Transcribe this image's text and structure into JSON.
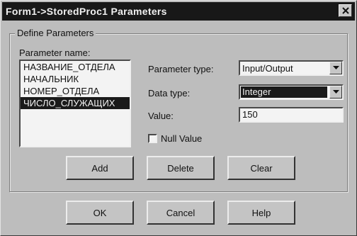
{
  "window": {
    "title": "Form1->StoredProc1 Parameters"
  },
  "group": {
    "title": "Define Parameters",
    "param_name_label": "Parameter name:",
    "parameters": [
      "НАЗВАНИЕ_ОТДЕЛА",
      "НАЧАЛЬНИК",
      "НОМЕР_ОТДЕЛА",
      "ЧИСЛО_СЛУЖАЩИХ"
    ],
    "selected_parameter": "ЧИСЛО_СЛУЖАЩИХ",
    "param_type_label": "Parameter type:",
    "param_type_value": "Input/Output",
    "data_type_label": "Data type:",
    "data_type_value": "Integer",
    "value_label": "Value:",
    "value": "150",
    "null_value_label": "Null Value",
    "null_value_checked": false,
    "buttons": {
      "add": "Add",
      "delete": "Delete",
      "clear": "Clear"
    }
  },
  "footer": {
    "ok": "OK",
    "cancel": "Cancel",
    "help": "Help"
  },
  "icons": {
    "close": "close-icon",
    "dropdown": "chevron-down-icon"
  },
  "colors": {
    "titlebar": "#181818",
    "face": "#bdbdbd",
    "selection": "#1a1a1a"
  }
}
